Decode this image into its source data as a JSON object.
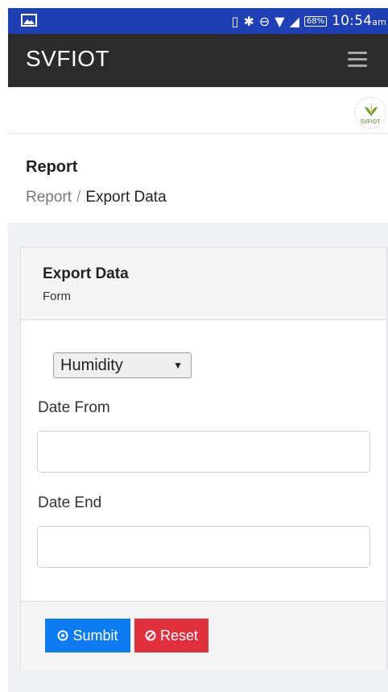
{
  "status_bar": {
    "time": "10:54",
    "time_suffix": "am",
    "battery": "68%",
    "accent": "#1f3fb5"
  },
  "app_bar": {
    "title": "SVFIOT",
    "menu_icon": "hamburger-menu-icon",
    "background": "#2b2b2b"
  },
  "logo": {
    "text": "SVFIOT",
    "icon": "leaf-logo-icon"
  },
  "page": {
    "heading": "Report",
    "breadcrumb": {
      "home": "Report",
      "separator": "/",
      "current": "Export Data"
    }
  },
  "card": {
    "title": "Export Data",
    "subtitle": "Form",
    "sensor_select": {
      "selected": "Humidity"
    },
    "date_from": {
      "label": "Date From",
      "value": ""
    },
    "date_end": {
      "label": "Date End",
      "value": ""
    },
    "buttons": {
      "submit": {
        "label": "Sumbit",
        "icon": "circle-dot-icon",
        "color": "#0d7cf2"
      },
      "reset": {
        "label": "Reset",
        "icon": "circle-slash-icon",
        "color": "#e0303e"
      }
    }
  }
}
